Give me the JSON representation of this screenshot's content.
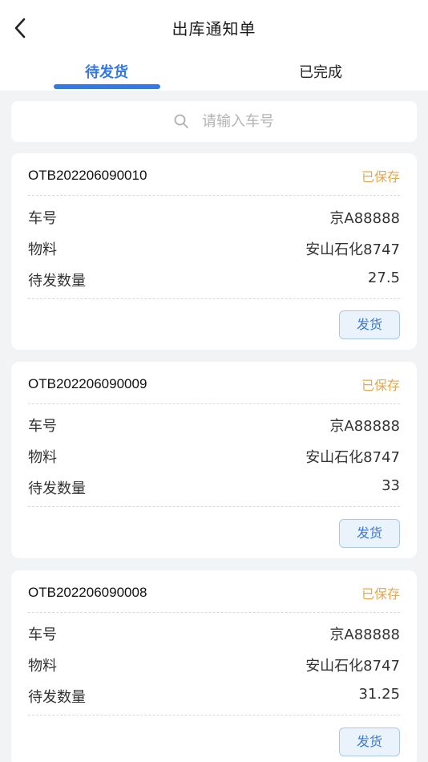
{
  "header": {
    "title": "出库通知单",
    "back_icon": "chevron-left-icon"
  },
  "tabs": [
    {
      "label": "待发货",
      "active": true
    },
    {
      "label": "已完成",
      "active": false
    }
  ],
  "colors": {
    "accent": "#3478e6",
    "status_saved": "#e3a850",
    "button_bg": "#eaf2fb"
  },
  "search": {
    "placeholder": "请输入车号",
    "value": ""
  },
  "labels": {
    "plate": "车号",
    "material": "物料",
    "qty": "待发数量"
  },
  "orders": [
    {
      "id": "OTB202206090010",
      "status": "已保存",
      "plate": "京A88888",
      "material": "安山石化8747",
      "qty": "27.5",
      "button": "发货"
    },
    {
      "id": "OTB202206090009",
      "status": "已保存",
      "plate": "京A88888",
      "material": "安山石化8747",
      "qty": "33",
      "button": "发货"
    },
    {
      "id": "OTB202206090008",
      "status": "已保存",
      "plate": "京A88888",
      "material": "安山石化8747",
      "qty": "31.25",
      "button": "发货"
    }
  ]
}
